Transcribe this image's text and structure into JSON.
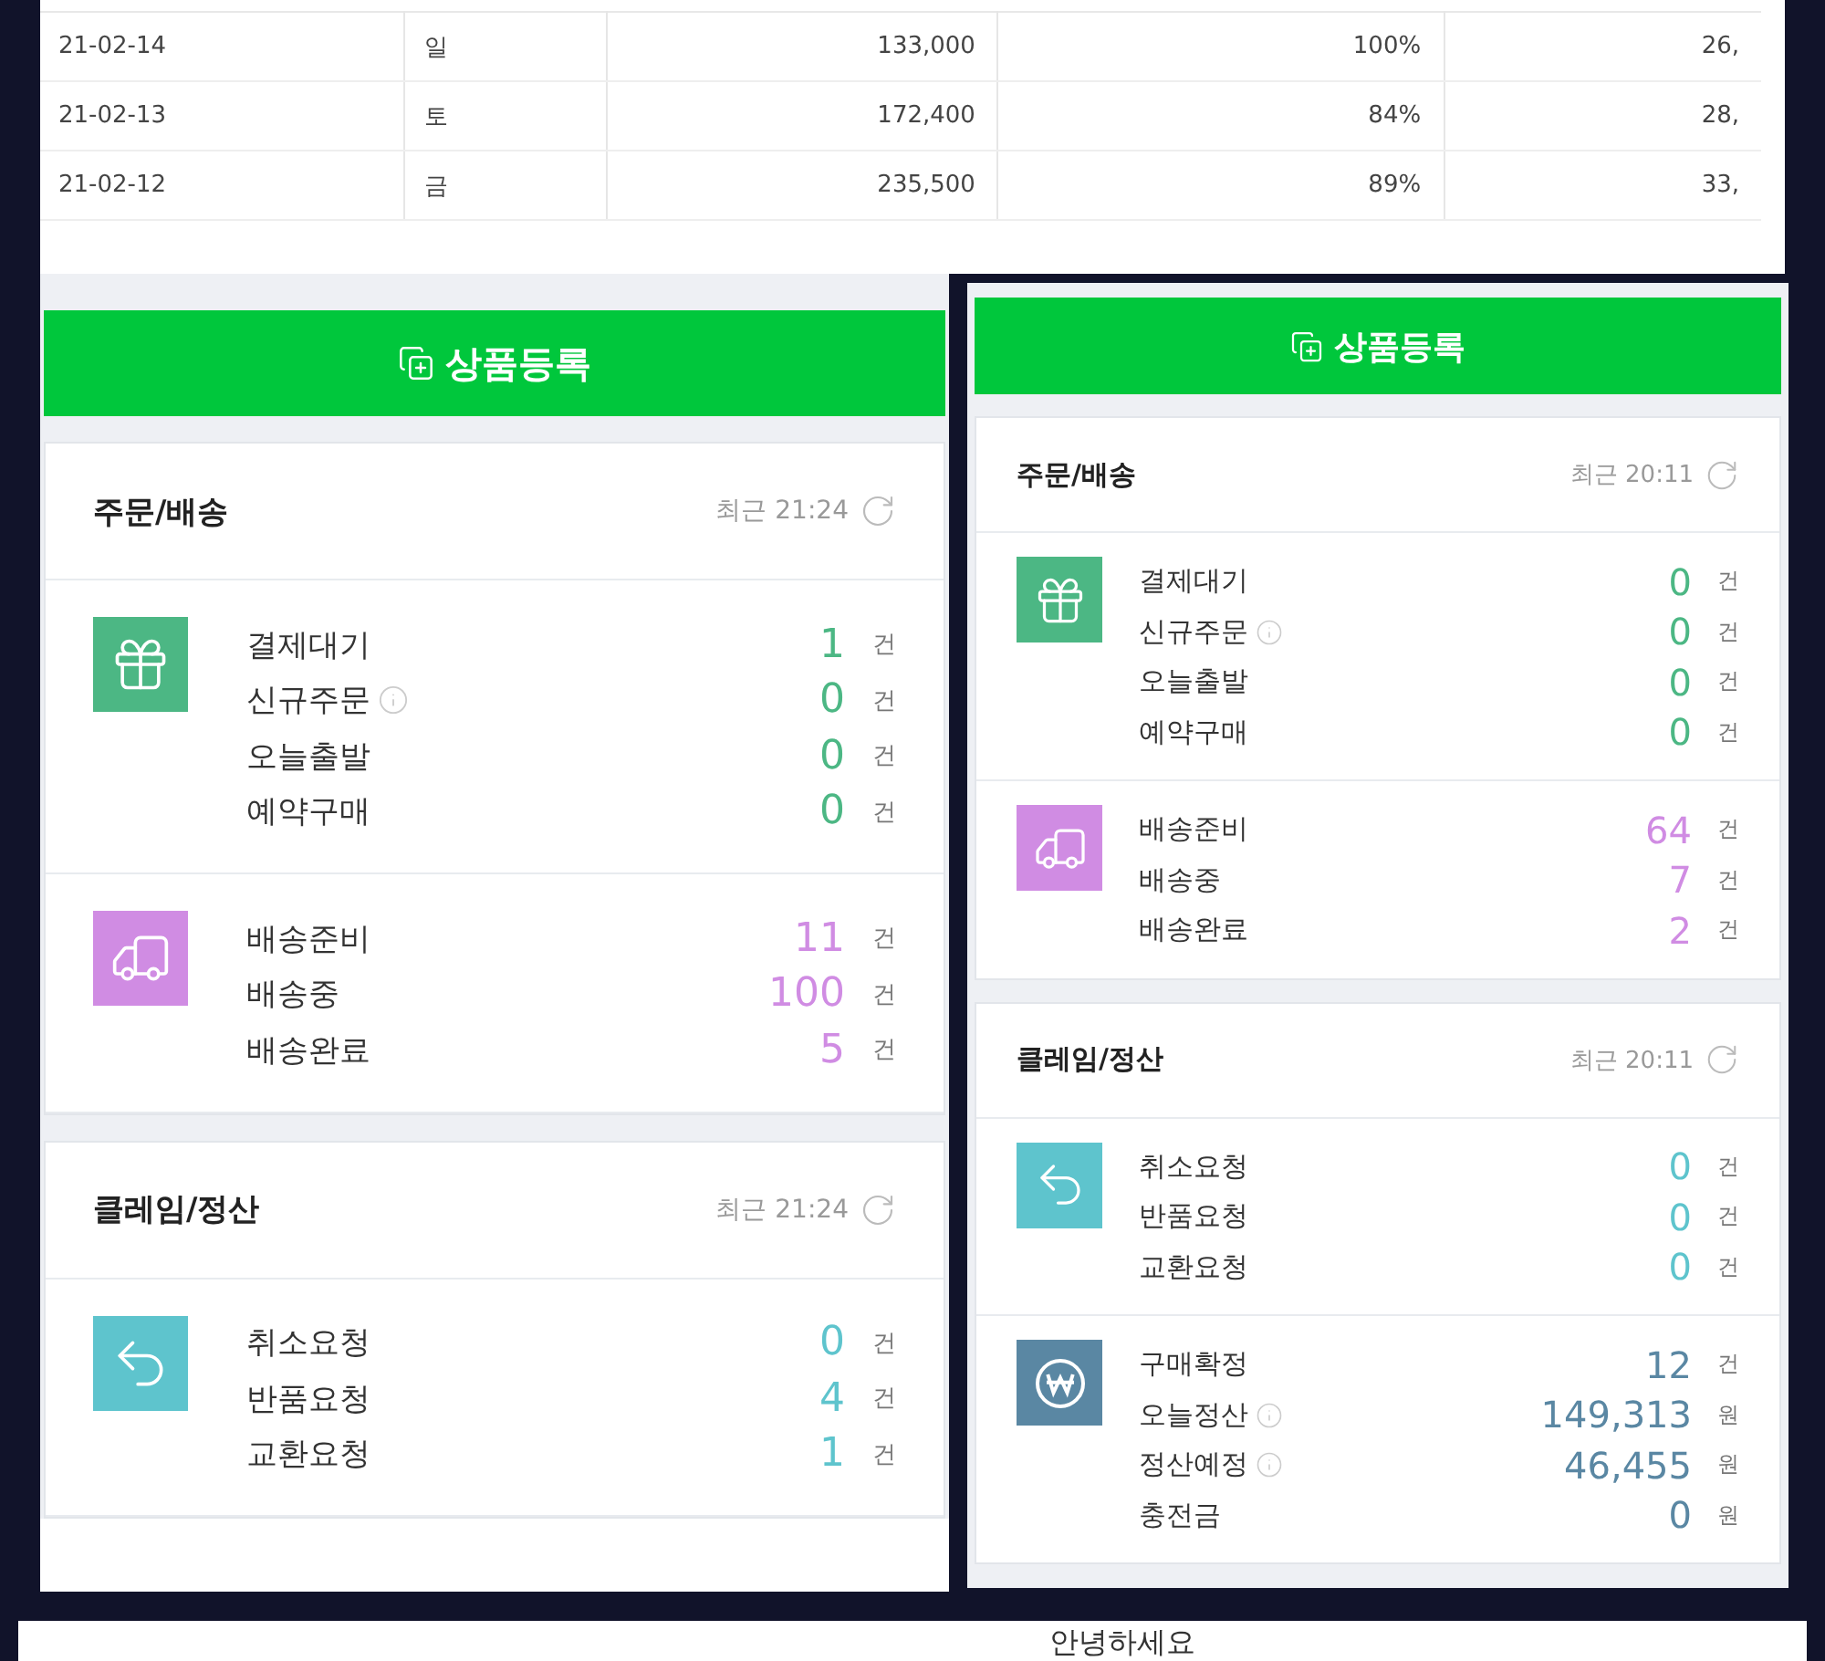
{
  "sales_table": {
    "rows": [
      {
        "date": "21-02-14",
        "day": "일",
        "amount": "133,000",
        "rate": "100%",
        "column_5": "26,"
      },
      {
        "date": "21-02-13",
        "day": "토",
        "amount": "172,400",
        "rate": "84%",
        "column_5": "28,"
      },
      {
        "date": "21-02-12",
        "day": "금",
        "amount": "235,500",
        "rate": "89%",
        "column_5": "33,"
      }
    ]
  },
  "panels": [
    {
      "register_button": "상품등록",
      "sections": [
        {
          "title": "주문/배송",
          "updated": "최근 21:24",
          "groups": [
            {
              "kind": "gift",
              "color": "#4cb784",
              "items": [
                {
                  "label": "결제대기",
                  "info": false,
                  "value": "1",
                  "unit": "건"
                },
                {
                  "label": "신규주문",
                  "info": true,
                  "value": "0",
                  "unit": "건"
                },
                {
                  "label": "오늘출발",
                  "info": false,
                  "value": "0",
                  "unit": "건"
                },
                {
                  "label": "예약구매",
                  "info": false,
                  "value": "0",
                  "unit": "건"
                }
              ]
            },
            {
              "kind": "truck",
              "color": "#d08ce3",
              "items": [
                {
                  "label": "배송준비",
                  "info": false,
                  "value": "11",
                  "unit": "건"
                },
                {
                  "label": "배송중",
                  "info": false,
                  "value": "100",
                  "unit": "건"
                },
                {
                  "label": "배송완료",
                  "info": false,
                  "value": "5",
                  "unit": "건"
                }
              ]
            }
          ]
        },
        {
          "title": "클레임/정산",
          "updated": "최근 21:24",
          "groups": [
            {
              "kind": "return",
              "color": "#5ec4cd",
              "items": [
                {
                  "label": "취소요청",
                  "info": false,
                  "value": "0",
                  "unit": "건"
                },
                {
                  "label": "반품요청",
                  "info": false,
                  "value": "4",
                  "unit": "건"
                },
                {
                  "label": "교환요청",
                  "info": false,
                  "value": "1",
                  "unit": "건"
                }
              ]
            }
          ]
        }
      ]
    },
    {
      "register_button": "상품등록",
      "sections": [
        {
          "title": "주문/배송",
          "updated": "최근 20:11",
          "groups": [
            {
              "kind": "gift",
              "color": "#4cb784",
              "items": [
                {
                  "label": "결제대기",
                  "info": false,
                  "value": "0",
                  "unit": "건"
                },
                {
                  "label": "신규주문",
                  "info": true,
                  "value": "0",
                  "unit": "건"
                },
                {
                  "label": "오늘출발",
                  "info": false,
                  "value": "0",
                  "unit": "건"
                },
                {
                  "label": "예약구매",
                  "info": false,
                  "value": "0",
                  "unit": "건"
                }
              ]
            },
            {
              "kind": "truck",
              "color": "#d08ce3",
              "items": [
                {
                  "label": "배송준비",
                  "info": false,
                  "value": "64",
                  "unit": "건"
                },
                {
                  "label": "배송중",
                  "info": false,
                  "value": "7",
                  "unit": "건"
                },
                {
                  "label": "배송완료",
                  "info": false,
                  "value": "2",
                  "unit": "건"
                }
              ]
            }
          ]
        },
        {
          "title": "클레임/정산",
          "updated": "최근 20:11",
          "groups": [
            {
              "kind": "return",
              "color": "#5ec4cd",
              "items": [
                {
                  "label": "취소요청",
                  "info": false,
                  "value": "0",
                  "unit": "건"
                },
                {
                  "label": "반품요청",
                  "info": false,
                  "value": "0",
                  "unit": "건"
                },
                {
                  "label": "교환요청",
                  "info": false,
                  "value": "0",
                  "unit": "건"
                }
              ]
            },
            {
              "kind": "money",
              "color": "#5a87a3",
              "items": [
                {
                  "label": "구매확정",
                  "info": false,
                  "value": "12",
                  "unit": "건"
                },
                {
                  "label": "오늘정산",
                  "info": true,
                  "value": "149,313",
                  "unit": "원"
                },
                {
                  "label": "정산예정",
                  "info": true,
                  "value": "46,455",
                  "unit": "원"
                },
                {
                  "label": "충전금",
                  "info": false,
                  "value": "0",
                  "unit": "원"
                }
              ]
            }
          ]
        }
      ]
    }
  ],
  "greeting": "안녕하세요"
}
